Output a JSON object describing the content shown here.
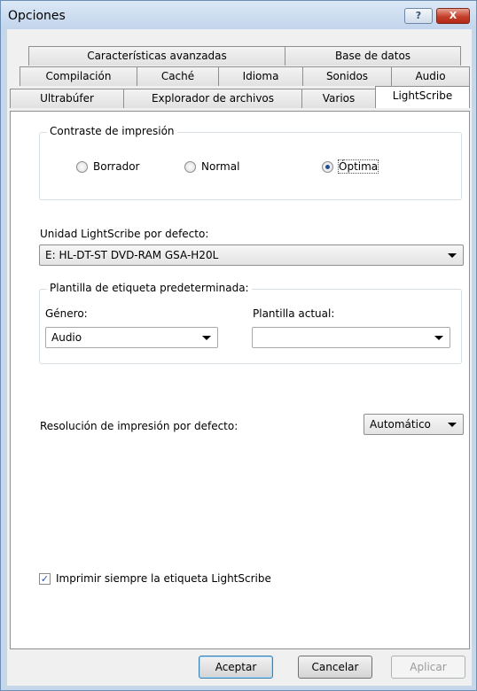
{
  "window": {
    "title": "Opciones",
    "help_label": "?",
    "close_label": "X"
  },
  "tabs": {
    "row1": [
      "Características avanzadas",
      "Base de datos"
    ],
    "row2": [
      "Compilación",
      "Caché",
      "Idioma",
      "Sonidos",
      "Audio"
    ],
    "row3": [
      "Ultrabúfer",
      "Explorador de archivos",
      "Varios",
      "LightScribe"
    ],
    "active": "LightScribe"
  },
  "contrast": {
    "title": "Contraste de impresión",
    "options": [
      "Borrador",
      "Normal",
      "Óptima"
    ],
    "selected": "Óptima"
  },
  "drive": {
    "label": "Unidad LightScribe por defecto:",
    "value": "E: HL-DT-ST DVD-RAM GSA-H20L"
  },
  "template": {
    "title": "Plantilla de etiqueta predeterminada:",
    "genre_label": "Género:",
    "genre_value": "Audio",
    "current_label": "Plantilla actual:",
    "current_value": ""
  },
  "resolution": {
    "label": "Resolución de impresión por defecto:",
    "value": "Automático"
  },
  "always_print": {
    "label": "Imprimir siempre la etiqueta LightScribe",
    "checked": true
  },
  "buttons": {
    "ok": "Aceptar",
    "cancel": "Cancelar",
    "apply": "Aplicar"
  }
}
